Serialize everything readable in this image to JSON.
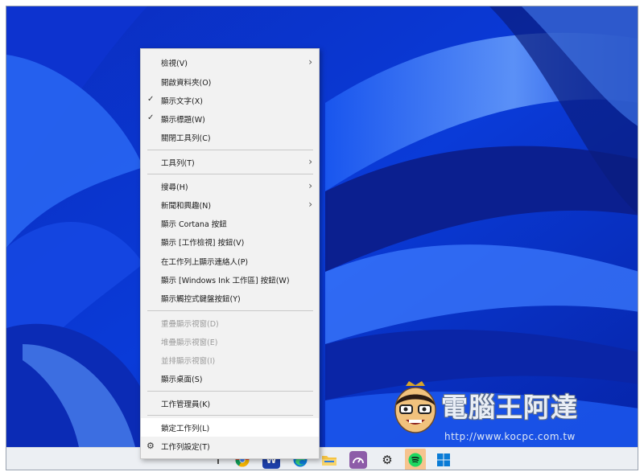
{
  "menu": {
    "items": [
      {
        "label": "檢視(V)",
        "submenu": true,
        "checked": false,
        "disabled": false
      },
      {
        "label": "開啟資料夾(O)",
        "submenu": false,
        "checked": false,
        "disabled": false
      },
      {
        "label": "顯示文字(X)",
        "submenu": false,
        "checked": true,
        "disabled": false
      },
      {
        "label": "顯示標題(W)",
        "submenu": false,
        "checked": true,
        "disabled": false
      },
      {
        "label": "關閉工具列(C)",
        "submenu": false,
        "checked": false,
        "disabled": false
      },
      {
        "label": "工具列(T)",
        "submenu": true,
        "checked": false,
        "disabled": false
      },
      {
        "label": "搜尋(H)",
        "submenu": true,
        "checked": false,
        "disabled": false
      },
      {
        "label": "新聞和興趣(N)",
        "submenu": true,
        "checked": false,
        "disabled": false
      },
      {
        "label": "顯示 Cortana 按鈕",
        "submenu": false,
        "checked": false,
        "disabled": false
      },
      {
        "label": "顯示 [工作檢視] 按鈕(V)",
        "submenu": false,
        "checked": false,
        "disabled": false
      },
      {
        "label": "在工作列上顯示連絡人(P)",
        "submenu": false,
        "checked": false,
        "disabled": false
      },
      {
        "label": "顯示 [Windows Ink 工作區] 按鈕(W)",
        "submenu": false,
        "checked": false,
        "disabled": false
      },
      {
        "label": "顯示觸控式鍵盤按鈕(Y)",
        "submenu": false,
        "checked": false,
        "disabled": false
      },
      {
        "label": "重疊顯示視窗(D)",
        "submenu": false,
        "checked": false,
        "disabled": true
      },
      {
        "label": "堆疊顯示視窗(E)",
        "submenu": false,
        "checked": false,
        "disabled": true
      },
      {
        "label": "並排顯示視窗(I)",
        "submenu": false,
        "checked": false,
        "disabled": true
      },
      {
        "label": "顯示桌面(S)",
        "submenu": false,
        "checked": false,
        "disabled": false
      },
      {
        "label": "工作管理員(K)",
        "submenu": false,
        "checked": false,
        "disabled": false
      },
      {
        "label": "鎖定工作列(L)",
        "submenu": false,
        "checked": false,
        "disabled": false,
        "highlighted": true
      },
      {
        "label": "工作列設定(T)",
        "submenu": false,
        "checked": false,
        "disabled": false,
        "icon": "gear-icon"
      }
    ]
  },
  "taskbar": {
    "icons": [
      "chrome-icon",
      "word-icon",
      "edge-icon",
      "folder-icon",
      "speed-gauge-icon",
      "settings-gear-icon",
      "spotify-icon",
      "windows-start-icon"
    ],
    "word_glyph": "W",
    "gear_glyph": "⚙"
  },
  "watermark": {
    "title": "電腦王阿達",
    "url": "http://www.kocpc.com.tw"
  },
  "colors": {
    "wallpaper_base": "#0a2fc9",
    "menu_bg": "#f2f2f2",
    "menu_highlight": "#ffffff",
    "spotify_green": "#1ed760",
    "start_blue": "#0a7bd6",
    "active_tile": "#f6c48f"
  }
}
